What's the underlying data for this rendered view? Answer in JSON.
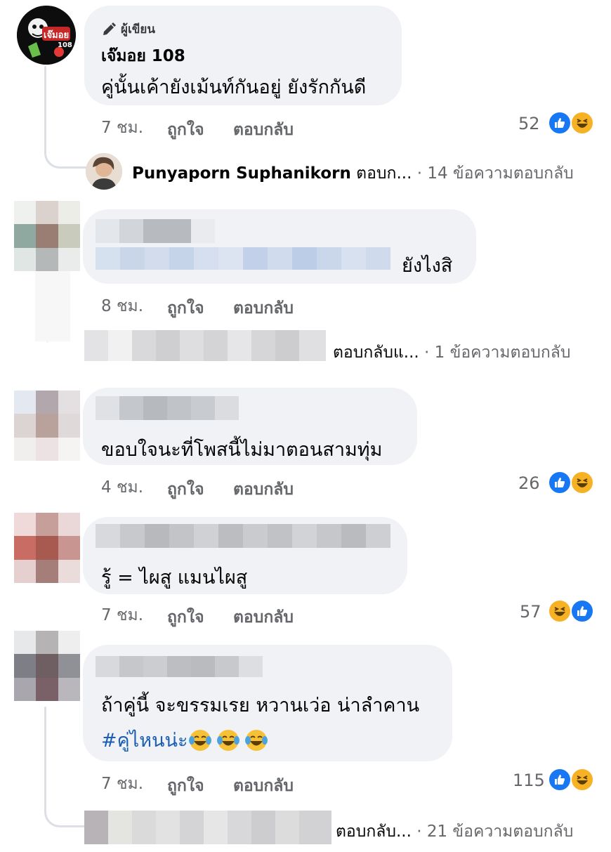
{
  "comments": [
    {
      "author_badge": "ผู้เขียน",
      "name": "เจ๊มอย 108",
      "avatar_text": "เจ๊มอย",
      "avatar_num": "108",
      "text": "คู่นั้นเค้ายังเม้นท์กันอยู่ ยังรักกันดี",
      "time": "7 ชม.",
      "like_label": "ถูกใจ",
      "reply_label": "ตอบกลับ",
      "count": "52",
      "reply": {
        "name": "Punyaporn Suphanikorn",
        "action": "ตอบก...",
        "meta": "· 14 ข้อความตอบกลับ"
      }
    },
    {
      "text": "ยังไงสิ",
      "time": "8 ชม.",
      "like_label": "ถูกใจ",
      "reply_label": "ตอบกลับ",
      "reply": {
        "action": "ตอบกลับแ...",
        "meta": "· 1 ข้อความตอบกลับ"
      }
    },
    {
      "text": "ขอบใจนะที่โพสนี้ไม่มาตอนสามทุ่ม",
      "time": "4 ชม.",
      "like_label": "ถูกใจ",
      "reply_label": "ตอบกลับ",
      "count": "26"
    },
    {
      "text": "รู้ = ไผสู แมนไผสู",
      "time": "7 ชม.",
      "like_label": "ถูกใจ",
      "reply_label": "ตอบกลับ",
      "count": "57"
    },
    {
      "text": "ถ้าคู่นี้ จะขรรมเรย  หวานเว่อ น่าลำคาน",
      "hashtag": "#คู่ไหนน่ะ",
      "time": "7 ชม.",
      "like_label": "ถูกใจ",
      "reply_label": "ตอบกลับ",
      "count": "115",
      "reply": {
        "action": "ตอบกลับ...",
        "meta": "· 21 ข้อความตอบกลับ"
      }
    }
  ],
  "colors": {
    "like": "#1877f2",
    "haha": "#f7b125",
    "bubble": "#f0f2f5",
    "meta": "#65676b",
    "hashtag": "#1a5fb4"
  },
  "icons": [
    "pencil-icon",
    "like-reaction-icon",
    "haha-reaction-icon",
    "tears-of-joy-emoji"
  ]
}
